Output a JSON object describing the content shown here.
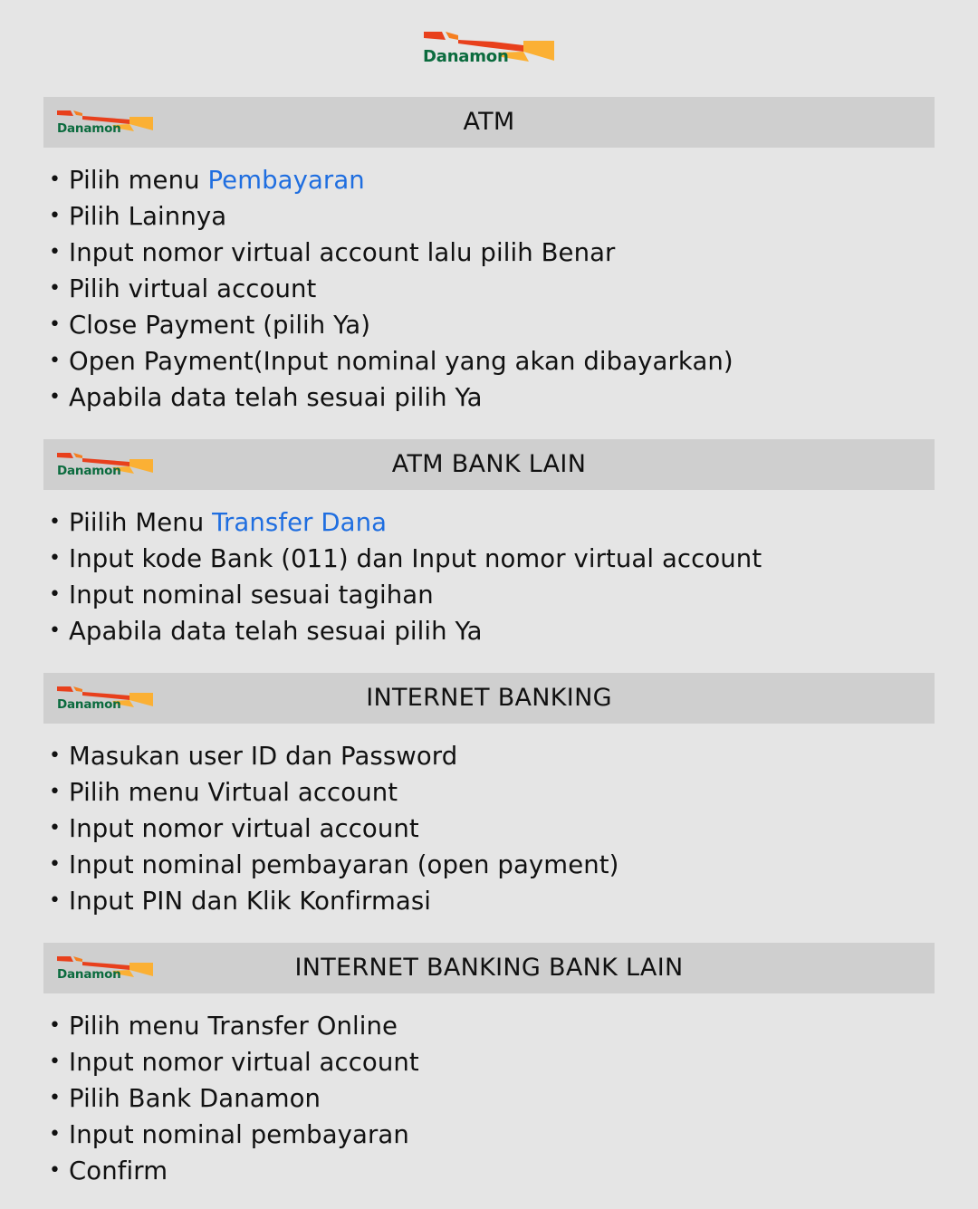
{
  "brand": {
    "name": "Danamon",
    "colors": {
      "green": "#0b6b3e",
      "red": "#e8401c",
      "orange": "#f57f20",
      "yellow": "#fbb034",
      "link": "#1f6ee0",
      "header_bg": "#cfcfcf",
      "page_bg": "#e5e5e5"
    }
  },
  "sections": [
    {
      "title": "ATM",
      "logo_text": "Danamon",
      "steps": [
        {
          "text": "Pilih menu ",
          "link": "Pembayaran"
        },
        {
          "text": "Pilih Lainnya"
        },
        {
          "text": "Input nomor virtual account lalu pilih Benar"
        },
        {
          "text": "Pilih virtual account"
        },
        {
          "text": "Close Payment (pilih Ya)"
        },
        {
          "text": "Open Payment(Input nominal yang akan dibayarkan)"
        },
        {
          "text": "Apabila data telah sesuai pilih Ya"
        }
      ]
    },
    {
      "title": "ATM BANK LAIN",
      "logo_text": "Danamon",
      "steps": [
        {
          "text": "Piilih Menu ",
          "link": "Transfer Dana"
        },
        {
          "text": "Input kode Bank (011) dan Input nomor virtual account"
        },
        {
          "text": "Input nominal sesuai tagihan"
        },
        {
          "text": "Apabila data telah sesuai pilih Ya"
        }
      ]
    },
    {
      "title": "INTERNET BANKING",
      "logo_text": "Danamon",
      "steps": [
        {
          "text": "Masukan user ID dan Password"
        },
        {
          "text": "Pilih menu Virtual account"
        },
        {
          "text": "Input nomor virtual account"
        },
        {
          "text": "Input nominal pembayaran (open payment)"
        },
        {
          "text": "Input PIN dan Klik Konfirmasi"
        }
      ]
    },
    {
      "title": "INTERNET BANKING BANK LAIN",
      "logo_text": "Danamon",
      "steps": [
        {
          "text": "Pilih menu Transfer Online"
        },
        {
          "text": "Input nomor virtual account"
        },
        {
          "text": "Pilih Bank Danamon"
        },
        {
          "text": "Input nominal pembayaran"
        },
        {
          "text": "Confirm"
        }
      ]
    }
  ],
  "bullet": "•"
}
